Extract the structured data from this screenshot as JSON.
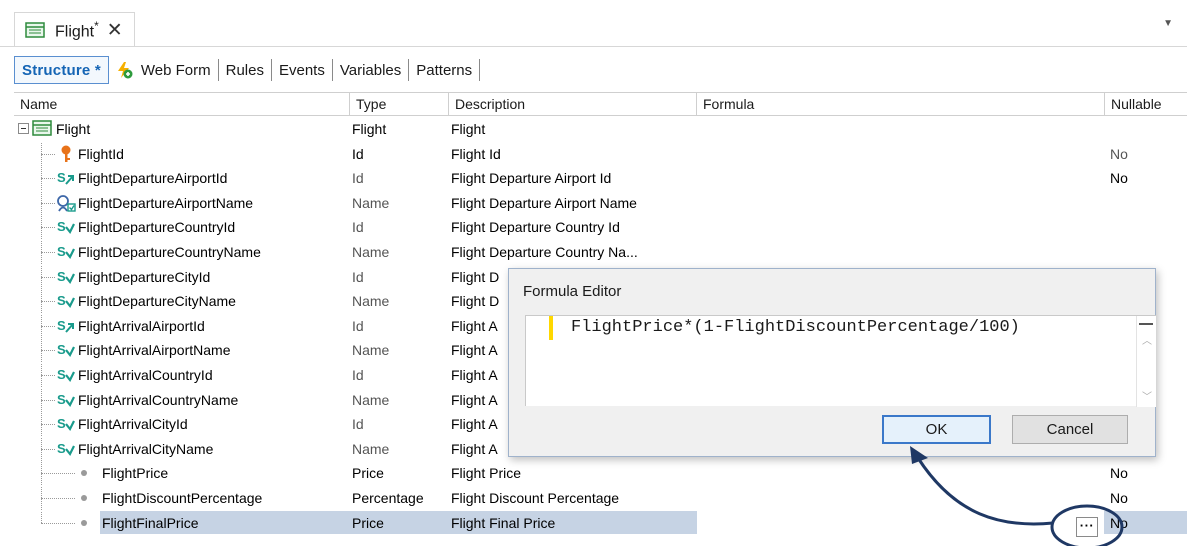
{
  "doc_tab": {
    "title": "Flight",
    "modified_marker": "*",
    "close": "✕"
  },
  "subtabs": [
    {
      "label": "Structure *",
      "active": true
    },
    {
      "label": "Web Form"
    },
    {
      "label": "Rules"
    },
    {
      "label": "Events"
    },
    {
      "label": "Variables"
    },
    {
      "label": "Patterns"
    }
  ],
  "grid": {
    "columns": [
      "Name",
      "Type",
      "Description",
      "Formula",
      "Nullable"
    ],
    "rows": [
      {
        "name": "Flight",
        "type": "Flight",
        "description": "Flight",
        "nullable": "",
        "icon": "transaction-icon"
      },
      {
        "name": "FlightId",
        "type": "Id",
        "description": "Flight Id",
        "nullable": "No",
        "icon": "key-icon"
      },
      {
        "name": "FlightDepartureAirportId",
        "type": "Id",
        "description": "Flight Departure Airport Id",
        "nullable": "No",
        "icon": "subtype-fk-icon"
      },
      {
        "name": "FlightDepartureAirportName",
        "type": "Name",
        "description": "Flight Departure Airport Name",
        "nullable": "",
        "icon": "search-description-icon"
      },
      {
        "name": "FlightDepartureCountryId",
        "type": "Id",
        "description": "Flight Departure Country Id",
        "nullable": "",
        "icon": "subtype-inferred-icon"
      },
      {
        "name": "FlightDepartureCountryName",
        "type": "Name",
        "description": "Flight Departure Country Na...",
        "nullable": "",
        "icon": "subtype-inferred-icon"
      },
      {
        "name": "FlightDepartureCityId",
        "type": "Id",
        "description": "Flight D",
        "nullable": "",
        "icon": "subtype-inferred-icon"
      },
      {
        "name": "FlightDepartureCityName",
        "type": "Name",
        "description": "Flight D",
        "nullable": "",
        "icon": "subtype-inferred-icon"
      },
      {
        "name": "FlightArrivalAirportId",
        "type": "Id",
        "description": "Flight A",
        "nullable": "",
        "icon": "subtype-fk-icon"
      },
      {
        "name": "FlightArrivalAirportName",
        "type": "Name",
        "description": "Flight A",
        "nullable": "",
        "icon": "subtype-inferred-icon"
      },
      {
        "name": "FlightArrivalCountryId",
        "type": "Id",
        "description": "Flight A",
        "nullable": "",
        "icon": "subtype-inferred-icon"
      },
      {
        "name": "FlightArrivalCountryName",
        "type": "Name",
        "description": "Flight A",
        "nullable": "",
        "icon": "subtype-inferred-icon"
      },
      {
        "name": "FlightArrivalCityId",
        "type": "Id",
        "description": "Flight A",
        "nullable": "",
        "icon": "subtype-inferred-icon"
      },
      {
        "name": "FlightArrivalCityName",
        "type": "Name",
        "description": "Flight A",
        "nullable": "",
        "icon": "subtype-inferred-icon"
      },
      {
        "name": "FlightPrice",
        "type": "Price",
        "description": "Flight Price",
        "nullable": "No",
        "icon": "attribute-dot-icon"
      },
      {
        "name": "FlightDiscountPercentage",
        "type": "Percentage",
        "description": "Flight Discount Percentage",
        "nullable": "No",
        "icon": "attribute-dot-icon"
      },
      {
        "name": "FlightFinalPrice",
        "type": "Price",
        "description": "Flight Final Price",
        "nullable": "No",
        "icon": "attribute-dot-icon",
        "selected": true
      }
    ]
  },
  "dialog": {
    "title": "Formula Editor",
    "formula": "FlightPrice*(1-FlightDiscountPercentage/100)",
    "ok_label": "OK",
    "cancel_label": "Cancel"
  },
  "ellipsis_label": "···",
  "colors": {
    "accent": "#1565b5",
    "selection": "#c6d3e4",
    "annotation": "#1f3864",
    "teal_icon": "#1a9b8c",
    "key_icon": "#e8731a"
  }
}
